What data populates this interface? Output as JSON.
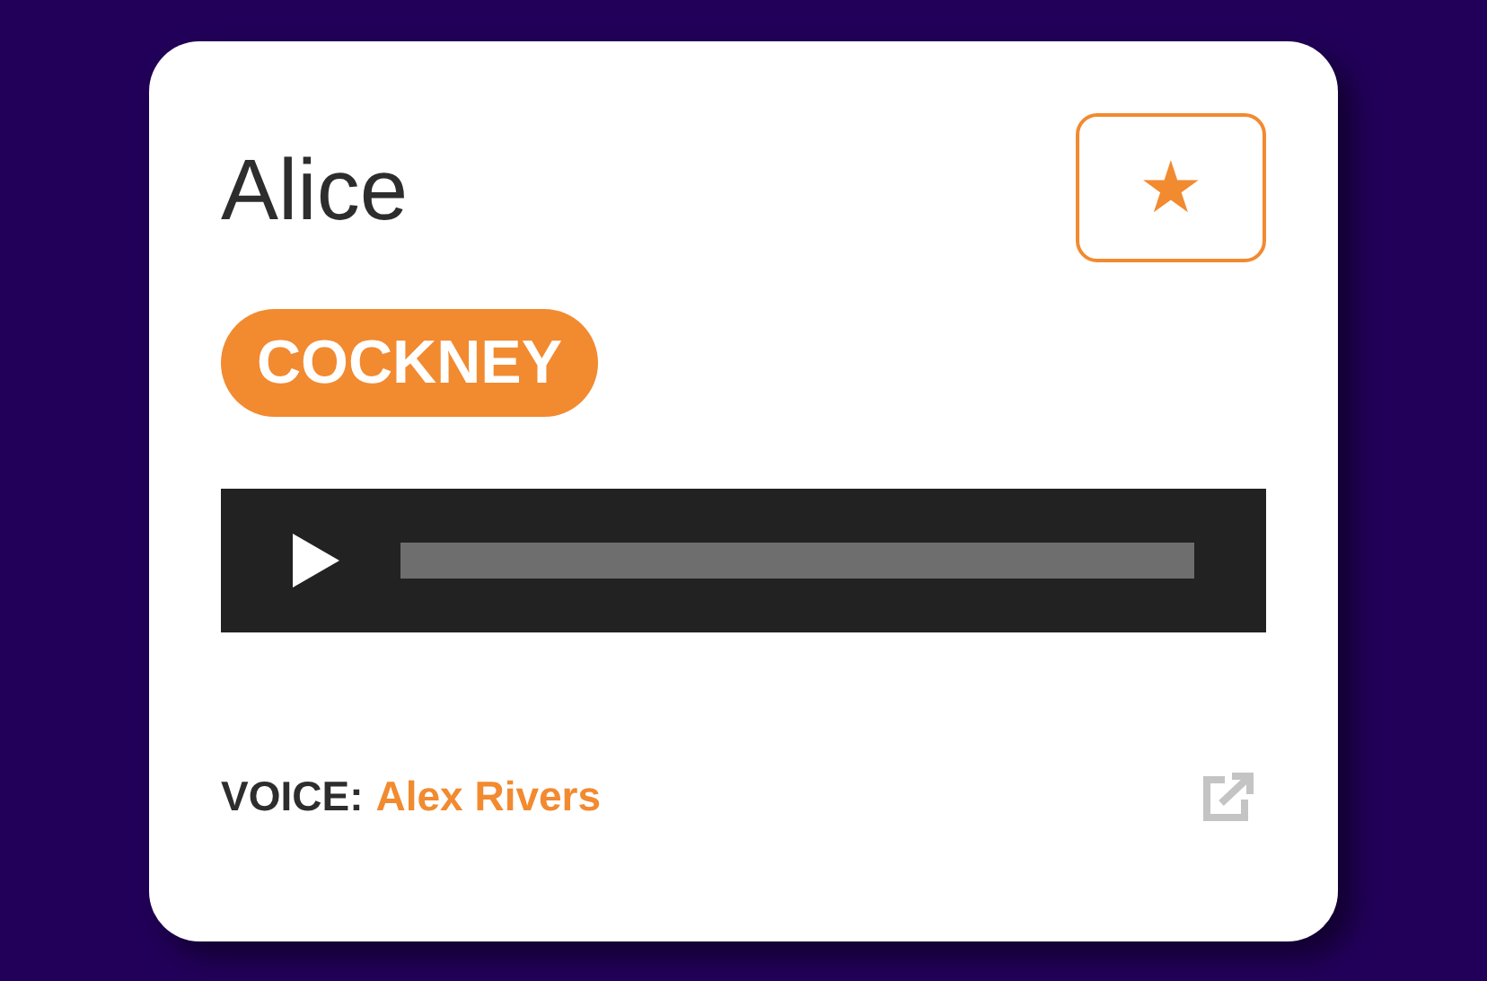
{
  "card": {
    "title": "Alice",
    "favorite_button": {
      "icon": "★"
    },
    "accent_badge": "COCKNEY",
    "voice": {
      "label": "VOICE:",
      "name": "Alex Rivers"
    }
  }
}
